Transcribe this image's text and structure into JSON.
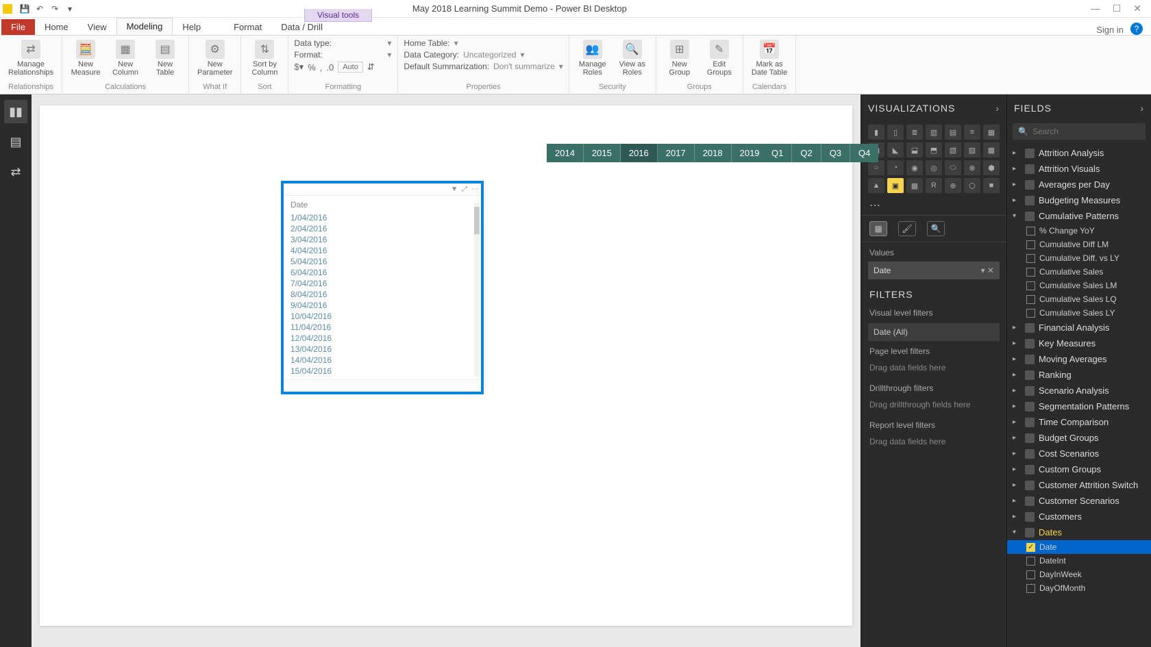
{
  "titlebar": {
    "visual_tools": "Visual tools",
    "doc_title": "May 2018 Learning Summit Demo - Power BI Desktop",
    "signin": "Sign in"
  },
  "ribbon_tabs": {
    "file": "File",
    "home": "Home",
    "view": "View",
    "modeling": "Modeling",
    "help": "Help",
    "format": "Format",
    "datadrill": "Data / Drill"
  },
  "ribbon": {
    "relationships": {
      "manage": "Manage\nRelationships",
      "group": "Relationships"
    },
    "calculations": {
      "new_measure": "New\nMeasure",
      "new_column": "New\nColumn",
      "new_table": "New\nTable",
      "group": "Calculations"
    },
    "whatif": {
      "new_param": "New\nParameter",
      "group": "What If"
    },
    "sort": {
      "sortby": "Sort by\nColumn",
      "group": "Sort"
    },
    "properties": {
      "datatype_lbl": "Data type:",
      "format_lbl": "Format:",
      "auto": "Auto",
      "hometable_lbl": "Home Table:",
      "datacat_lbl": "Data Category:",
      "datacat_val": "Uncategorized",
      "defsum_lbl": "Default Summarization:",
      "defsum_val": "Don't summarize",
      "group_fmt": "Formatting",
      "group_prop": "Properties"
    },
    "security": {
      "manage_roles": "Manage\nRoles",
      "view_as": "View as\nRoles",
      "group": "Security"
    },
    "groups": {
      "new_group": "New\nGroup",
      "edit_groups": "Edit\nGroups",
      "group": "Groups"
    },
    "calendars": {
      "mark": "Mark as\nDate Table",
      "group": "Calendars"
    }
  },
  "canvas": {
    "years": [
      "2014",
      "2015",
      "2016",
      "2017",
      "2018",
      "2019"
    ],
    "year_selected": "2016",
    "quarters": [
      "Q1",
      "Q2",
      "Q3",
      "Q4"
    ],
    "table": {
      "header": "Date",
      "rows": [
        "1/04/2016",
        "2/04/2016",
        "3/04/2016",
        "4/04/2016",
        "5/04/2016",
        "6/04/2016",
        "7/04/2016",
        "8/04/2016",
        "9/04/2016",
        "10/04/2016",
        "11/04/2016",
        "12/04/2016",
        "13/04/2016",
        "14/04/2016",
        "15/04/2016"
      ]
    }
  },
  "viz": {
    "title": "VISUALIZATIONS",
    "values_lbl": "Values",
    "value_field": "Date",
    "filters_title": "FILTERS",
    "vlf": "Visual level filters",
    "date_all": "Date (All)",
    "plf": "Page level filters",
    "drag1": "Drag data fields here",
    "dtf": "Drillthrough filters",
    "drag2": "Drag drillthrough fields here",
    "rlf": "Report level filters",
    "drag3": "Drag data fields here"
  },
  "fields": {
    "title": "FIELDS",
    "search_ph": "Search",
    "tables": [
      "Attrition Analysis",
      "Attrition Visuals",
      "Averages per Day",
      "Budgeting Measures"
    ],
    "cumulative": {
      "name": "Cumulative Patterns",
      "cols": [
        "% Change YoY",
        "Cumulative Diff LM",
        "Cumulative Diff. vs LY",
        "Cumulative Sales",
        "Cumulative Sales LM",
        "Cumulative Sales LQ",
        "Cumulative Sales LY"
      ]
    },
    "tables2": [
      "Financial Analysis",
      "Key Measures",
      "Moving Averages",
      "Ranking",
      "Scenario Analysis",
      "Segmentation Patterns",
      "Time Comparison",
      "Budget Groups",
      "Cost Scenarios",
      "Custom Groups",
      "Customer Attrition Switch",
      "Customer Scenarios",
      "Customers"
    ],
    "dates": {
      "name": "Dates",
      "cols": [
        {
          "n": "Date",
          "checked": true,
          "sel": true
        },
        {
          "n": "DateInt",
          "checked": false
        },
        {
          "n": "DayInWeek",
          "checked": false
        },
        {
          "n": "DayOfMonth",
          "checked": false
        }
      ]
    }
  }
}
